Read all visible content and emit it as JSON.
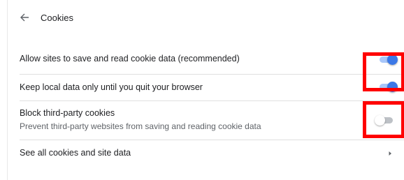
{
  "header": {
    "title": "Cookies",
    "back_icon": "arrow-left-icon"
  },
  "settings": {
    "allow_sites": {
      "label": "Allow sites to save and read cookie data (recommended)",
      "enabled": true
    },
    "keep_local": {
      "label": "Keep local data only until you quit your browser",
      "enabled": true
    },
    "block_third_party": {
      "label": "Block third-party cookies",
      "description": "Prevent third-party websites from saving and reading cookie data",
      "enabled": false
    },
    "see_all": {
      "label": "See all cookies and site data",
      "icon": "chevron-right-icon"
    }
  },
  "colors": {
    "toggle_on_knob": "#3b78e7",
    "toggle_on_track": "#a8c7fa",
    "toggle_off_track": "#bdc1c6",
    "highlight": "#ff0000"
  }
}
